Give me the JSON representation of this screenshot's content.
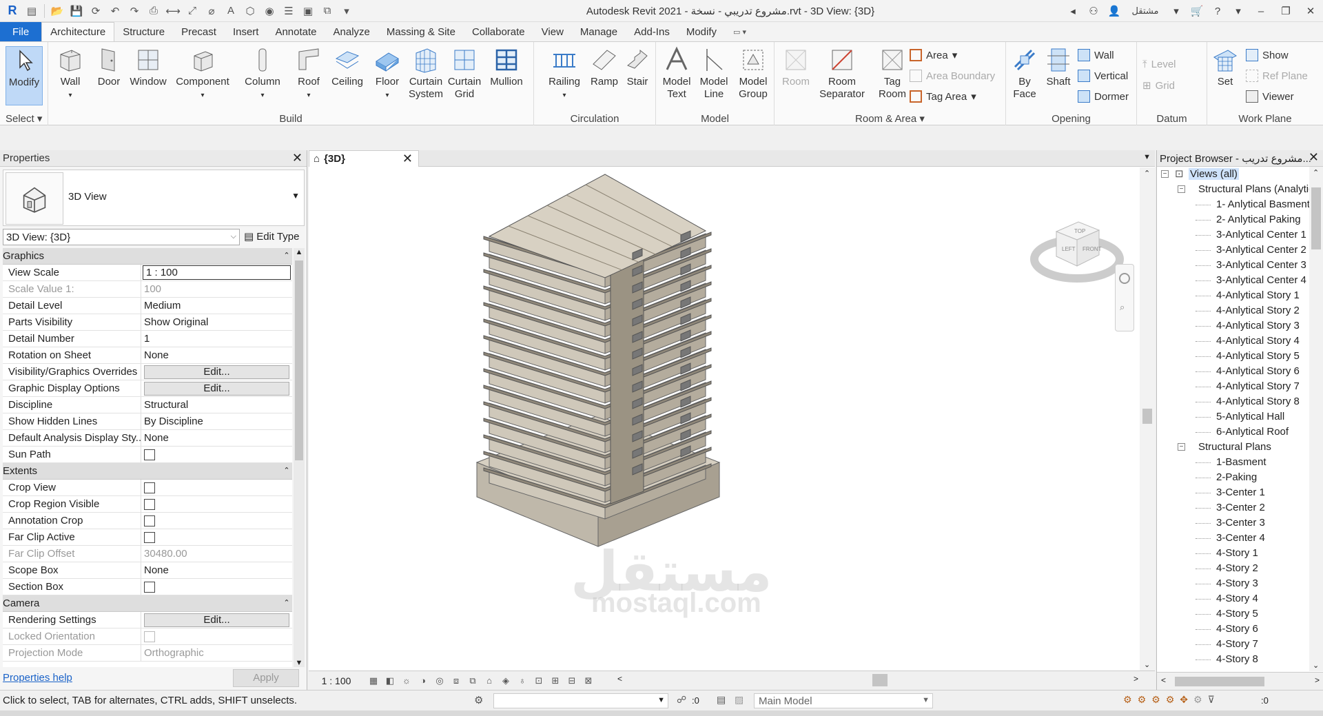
{
  "title_bar": {
    "title": "Autodesk Revit 2021 - مشروع تدريبي - نسخة.rvt - 3D View: {3D}",
    "signin": "مشتقل"
  },
  "ribbon_tabs": [
    "File",
    "Architecture",
    "Structure",
    "Precast",
    "Insert",
    "Annotate",
    "Analyze",
    "Massing & Site",
    "Collaborate",
    "View",
    "Manage",
    "Add-Ins",
    "Modify"
  ],
  "active_tab": "Architecture",
  "ribbon": {
    "select": {
      "modify": "Modify",
      "label": "Select"
    },
    "build": {
      "label": "Build",
      "buttons": [
        "Wall",
        "Door",
        "Window",
        "Component",
        "Column",
        "Roof",
        "Ceiling",
        "Floor",
        "Curtain System",
        "Curtain Grid",
        "Mullion"
      ]
    },
    "circulation": {
      "label": "Circulation",
      "buttons": [
        "Railing",
        "Ramp",
        "Stair"
      ]
    },
    "model": {
      "label": "Model",
      "buttons": [
        "Model Text",
        "Model Line",
        "Model Group"
      ]
    },
    "room_area": {
      "label": "Room & Area",
      "room": "Room",
      "room_separator": "Room Separator",
      "tag_room": "Tag Room",
      "area": "Area",
      "area_boundary": "Area Boundary",
      "tag_area": "Tag Area"
    },
    "opening": {
      "label": "Opening",
      "by_face": "By Face",
      "shaft": "Shaft",
      "wall": "Wall",
      "vertical": "Vertical",
      "dormer": "Dormer"
    },
    "datum": {
      "label": "Datum",
      "level": "Level",
      "grid": "Grid"
    },
    "work_plane": {
      "label": "Work Plane",
      "set": "Set",
      "show": "Show",
      "ref_plane": "Ref Plane",
      "viewer": "Viewer"
    }
  },
  "properties": {
    "header": "Properties",
    "type_name": "3D View",
    "view_selector": "3D View: {3D}",
    "edit_type": "Edit Type",
    "help": "Properties help",
    "apply": "Apply",
    "rows": [
      {
        "section": "Graphics"
      },
      {
        "k": "View Scale",
        "v": "1 : 100",
        "kind": "input"
      },
      {
        "k": "Scale Value    1:",
        "v": "100",
        "kind": "dis"
      },
      {
        "k": "Detail Level",
        "v": "Medium"
      },
      {
        "k": "Parts Visibility",
        "v": "Show Original"
      },
      {
        "k": "Detail Number",
        "v": "1"
      },
      {
        "k": "Rotation on Sheet",
        "v": "None"
      },
      {
        "k": "Visibility/Graphics Overrides",
        "v": "Edit...",
        "kind": "button"
      },
      {
        "k": "Graphic Display Options",
        "v": "Edit...",
        "kind": "button"
      },
      {
        "k": "Discipline",
        "v": "Structural"
      },
      {
        "k": "Show Hidden Lines",
        "v": "By Discipline"
      },
      {
        "k": "Default Analysis Display Sty...",
        "v": "None"
      },
      {
        "k": "Sun Path",
        "v": "",
        "kind": "check"
      },
      {
        "section": "Extents"
      },
      {
        "k": "Crop View",
        "v": "",
        "kind": "check"
      },
      {
        "k": "Crop Region Visible",
        "v": "",
        "kind": "check"
      },
      {
        "k": "Annotation Crop",
        "v": "",
        "kind": "check"
      },
      {
        "k": "Far Clip Active",
        "v": "",
        "kind": "check"
      },
      {
        "k": "Far Clip Offset",
        "v": "30480.00",
        "kind": "dis"
      },
      {
        "k": "Scope Box",
        "v": "None"
      },
      {
        "k": "Section Box",
        "v": "",
        "kind": "check"
      },
      {
        "section": "Camera"
      },
      {
        "k": "Rendering Settings",
        "v": "Edit...",
        "kind": "button"
      },
      {
        "k": "Locked Orientation",
        "v": "",
        "kind": "checkdis"
      },
      {
        "k": "Projection Mode",
        "v": "Orthographic",
        "kind": "dis"
      }
    ]
  },
  "view": {
    "tab_title": "{3D}",
    "scale": "1 : 100",
    "viewcube": {
      "top": "TOP",
      "front": "FRONT",
      "left": "LEFT"
    }
  },
  "browser": {
    "header": "Project Browser - مشروع تدريب...",
    "tree": [
      {
        "label": "Views (all)",
        "level": 0,
        "exp": "−",
        "sel": true
      },
      {
        "label": "Structural Plans (Analytical)",
        "level": 1,
        "exp": "−"
      },
      {
        "label": "1- Anlytical Basment",
        "level": 2
      },
      {
        "label": "2-  Anlytical Paking",
        "level": 2
      },
      {
        "label": "3-Anlytical Center 1",
        "level": 2
      },
      {
        "label": "3-Anlytical Center 2",
        "level": 2
      },
      {
        "label": "3-Anlytical Center 3",
        "level": 2
      },
      {
        "label": "3-Anlytical Center 4",
        "level": 2
      },
      {
        "label": "4-Anlytical Story 1",
        "level": 2
      },
      {
        "label": "4-Anlytical Story 2",
        "level": 2
      },
      {
        "label": "4-Anlytical Story 3",
        "level": 2
      },
      {
        "label": "4-Anlytical Story 4",
        "level": 2
      },
      {
        "label": "4-Anlytical Story 5",
        "level": 2
      },
      {
        "label": "4-Anlytical Story 6",
        "level": 2
      },
      {
        "label": "4-Anlytical Story 7",
        "level": 2
      },
      {
        "label": "4-Anlytical Story 8",
        "level": 2
      },
      {
        "label": "5-Anlytical Hall",
        "level": 2
      },
      {
        "label": "6-Anlytical Roof",
        "level": 2
      },
      {
        "label": "Structural Plans",
        "level": 1,
        "exp": "−"
      },
      {
        "label": "1-Basment",
        "level": 2
      },
      {
        "label": "2-Paking",
        "level": 2
      },
      {
        "label": "3-Center 1",
        "level": 2
      },
      {
        "label": "3-Center 2",
        "level": 2
      },
      {
        "label": "3-Center 3",
        "level": 2
      },
      {
        "label": "3-Center 4",
        "level": 2
      },
      {
        "label": "4-Story 1",
        "level": 2
      },
      {
        "label": "4-Story 2",
        "level": 2
      },
      {
        "label": "4-Story 3",
        "level": 2
      },
      {
        "label": "4-Story 4",
        "level": 2
      },
      {
        "label": "4-Story 5",
        "level": 2
      },
      {
        "label": "4-Story 6",
        "level": 2
      },
      {
        "label": "4-Story 7",
        "level": 2
      },
      {
        "label": "4-Story 8",
        "level": 2
      }
    ]
  },
  "status": {
    "message": "Click to select, TAB for alternates, CTRL adds, SHIFT unselects.",
    "zero_a": ":0",
    "model": "Main Model",
    "zero_b": ":0"
  },
  "watermark": {
    "main": "مستقل",
    "sub": "mostaql.com"
  }
}
